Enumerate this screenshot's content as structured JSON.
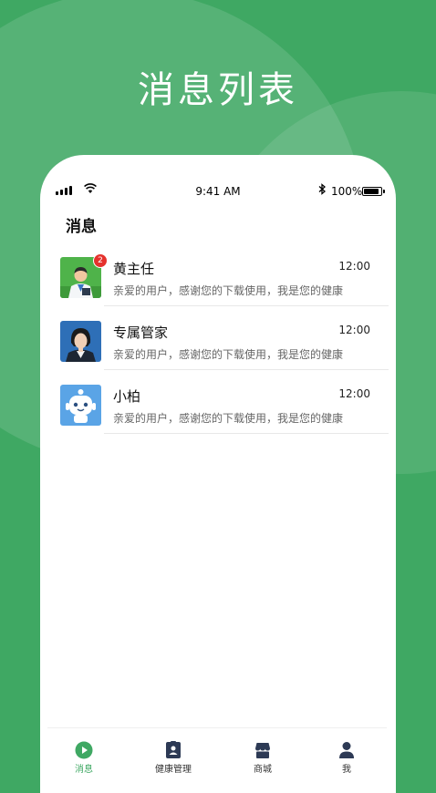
{
  "headline": "消息列表",
  "status_bar": {
    "time": "9:41 AM",
    "battery": "100%"
  },
  "page_title": "消息",
  "messages": [
    {
      "name": "黄主任",
      "time": "12:00",
      "preview": "亲爱的用户，感谢您的下载使用，我是您的健康",
      "badge": "2"
    },
    {
      "name": "专属管家",
      "time": "12:00",
      "preview": "亲爱的用户，感谢您的下载使用，我是您的健康"
    },
    {
      "name": "小柏",
      "time": "12:00",
      "preview": "亲爱的用户，感谢您的下载使用，我是您的健康"
    }
  ],
  "tabs": [
    {
      "label": "消息",
      "icon": "play-circle-icon",
      "active": true
    },
    {
      "label": "健康管理",
      "icon": "clipboard-icon",
      "active": false
    },
    {
      "label": "商城",
      "icon": "store-icon",
      "active": false
    },
    {
      "label": "我",
      "icon": "person-icon",
      "active": false
    }
  ],
  "colors": {
    "brand_green": "#3fa863",
    "badge_red": "#e5322d"
  }
}
